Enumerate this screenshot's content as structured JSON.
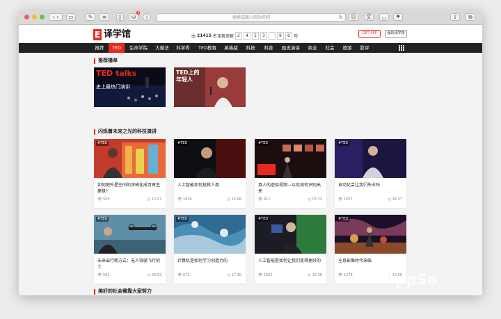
{
  "browser": {
    "url_placeholder": "搜索或输入网站名称",
    "traffic_lights": [
      "#ec5f57",
      "#f5bd31",
      "#5dc747"
    ],
    "badge": "8"
  },
  "header": {
    "logo_mark": "E",
    "logo_text": "译学馆",
    "counter_prefix": "由",
    "counter_users": "21415",
    "counter_suffix": "名译者贡献",
    "counter_digits": [
      "2",
      "4",
      "5",
      "3",
      "",
      "9",
      "6"
    ],
    "counter_end": "句",
    "get_app": "GET APP",
    "my_library": "我的译学馆"
  },
  "nav": {
    "items": [
      "推荐",
      "TED",
      "生命学院",
      "大循法",
      "科学秀",
      "TED教育",
      "英格威",
      "科技",
      "科普",
      "励志演讲",
      "商业",
      "社会",
      "旅游",
      "影评"
    ],
    "active_index": 1
  },
  "sections": [
    {
      "title": "推荐播单"
    },
    {
      "title": "闪烁着未来之光的科技演讲"
    },
    {
      "title": "美好的社会需靠大家努力"
    }
  ],
  "recommended": [
    {
      "line1": "TED talks",
      "line2": "史上最热门演讲"
    },
    {
      "line1": "TED上的",
      "line2": "年轻人"
    }
  ],
  "tag": "#TED",
  "cards": [
    {
      "title": "如何把外星空间的涂鸦化成可再生建筑?",
      "views": "509",
      "duration": "13:27"
    },
    {
      "title": "人工智能如何拯救人类",
      "views": "1636",
      "duration": "14:58"
    },
    {
      "title": "真人的虚拟视频—以及如何识别出来",
      "views": "611",
      "duration": "07:13"
    },
    {
      "title": "自动化会让我们失业吗",
      "views": "1507",
      "duration": "16:37"
    },
    {
      "title": "未来出行新方式：无人驾驶飞行的士",
      "views": "562",
      "duration": "08:03"
    },
    {
      "title": "计算机是如何学习创造力的",
      "views": "673",
      "duration": "17:36"
    },
    {
      "title": "人工智能是如何让我们变得更好的",
      "views": "1062",
      "duration": "12:38"
    },
    {
      "title": "全息影像时代来临",
      "views": "1378",
      "duration": "10:06"
    }
  ],
  "watermark": "AppSo",
  "colors": {
    "accent": "#e62b1e",
    "nav_bg": "#222222"
  }
}
